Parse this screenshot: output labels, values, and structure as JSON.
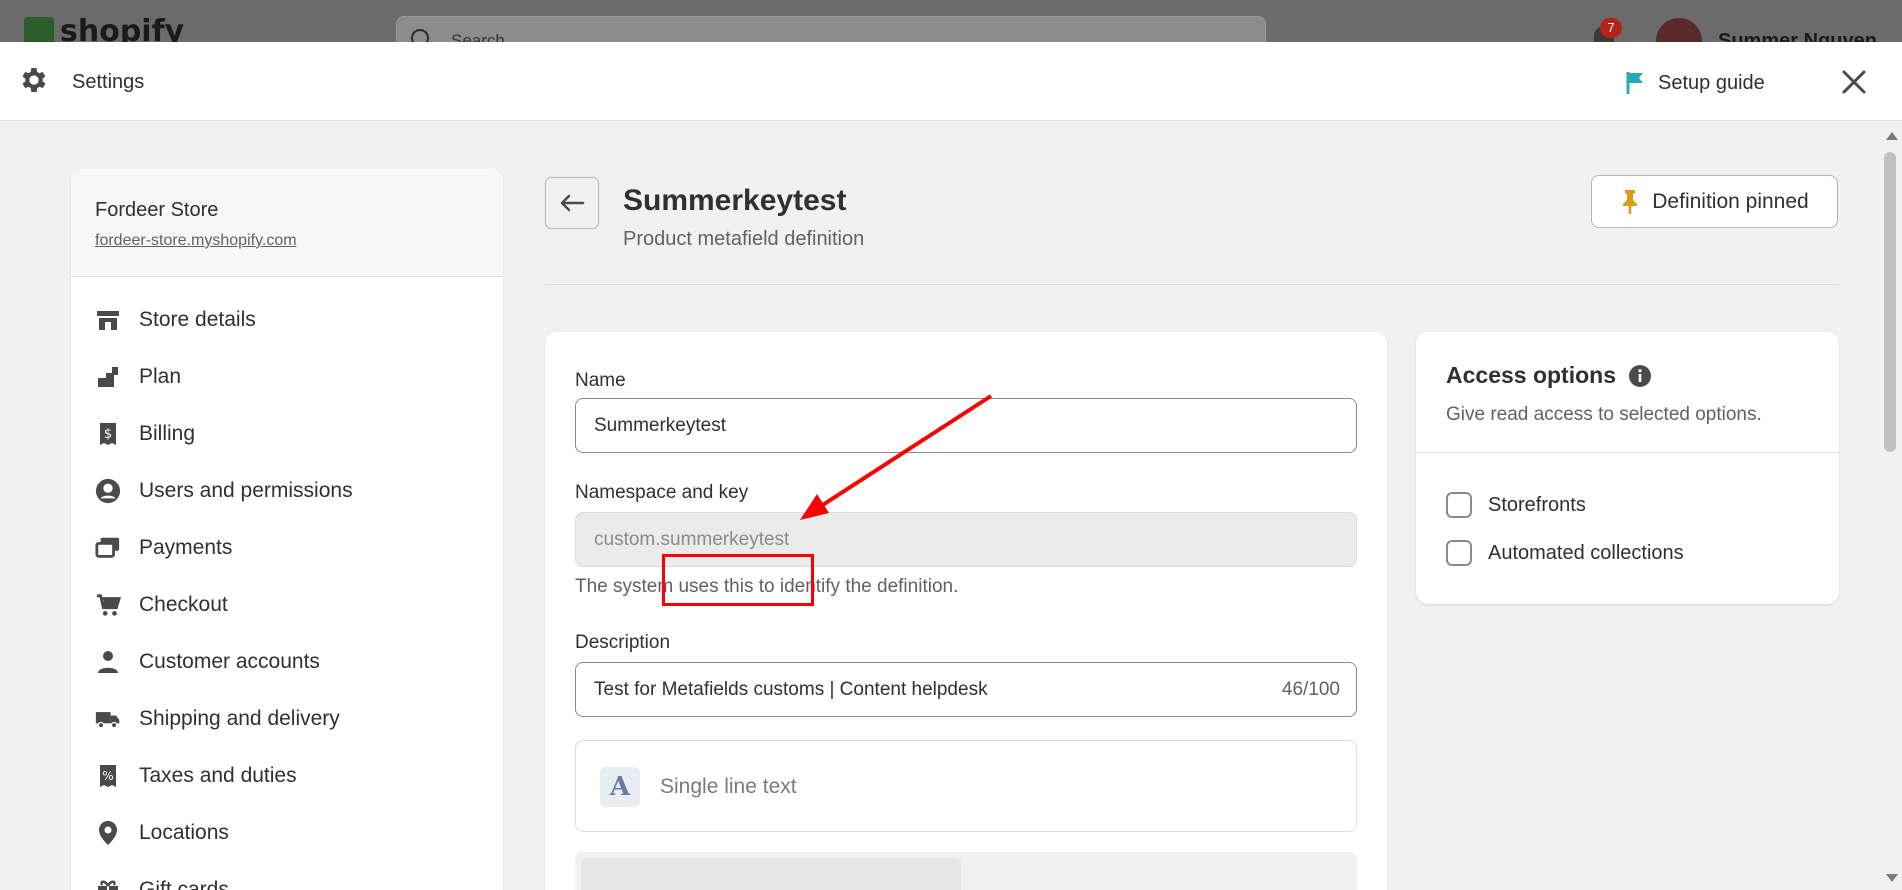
{
  "topbar": {
    "logo_text": "shopify",
    "search_placeholder": "Search",
    "notification_count": "7",
    "user_name": "Summer Nguyen"
  },
  "modal": {
    "title": "Settings",
    "setup_guide_label": "Setup guide"
  },
  "sidebar": {
    "store_name": "Fordeer Store",
    "store_url": "fordeer-store.myshopify.com",
    "items": [
      {
        "label": "Store details",
        "icon": "store-icon"
      },
      {
        "label": "Plan",
        "icon": "plan-icon"
      },
      {
        "label": "Billing",
        "icon": "billing-icon"
      },
      {
        "label": "Users and permissions",
        "icon": "user-circle-icon"
      },
      {
        "label": "Payments",
        "icon": "payments-icon"
      },
      {
        "label": "Checkout",
        "icon": "cart-icon"
      },
      {
        "label": "Customer accounts",
        "icon": "person-icon"
      },
      {
        "label": "Shipping and delivery",
        "icon": "truck-icon"
      },
      {
        "label": "Taxes and duties",
        "icon": "tax-icon"
      },
      {
        "label": "Locations",
        "icon": "location-pin-icon"
      },
      {
        "label": "Gift cards",
        "icon": "gift-icon"
      }
    ]
  },
  "page": {
    "title": "Summerkeytest",
    "subtitle": "Product metafield definition",
    "pinned_label": "Definition pinned"
  },
  "form": {
    "name_label": "Name",
    "name_value": "Summerkeytest",
    "namespace_label": "Namespace and key",
    "namespace_value": "custom.summerkeytest",
    "namespace_help": "The system uses this to identify the definition.",
    "description_label": "Description",
    "description_value": "Test for Metafields customs | Content helpdesk",
    "description_counter": "46/100",
    "type_icon_letter": "A",
    "type_label": "Single line text"
  },
  "access": {
    "title": "Access options",
    "subtitle": "Give read access to selected options.",
    "options": [
      {
        "label": "Storefronts",
        "checked": false
      },
      {
        "label": "Automated collections",
        "checked": false
      }
    ]
  },
  "colors": {
    "annotation": "#ff0000",
    "pin": "#e09a1a",
    "flag": "#2aa8b8"
  }
}
